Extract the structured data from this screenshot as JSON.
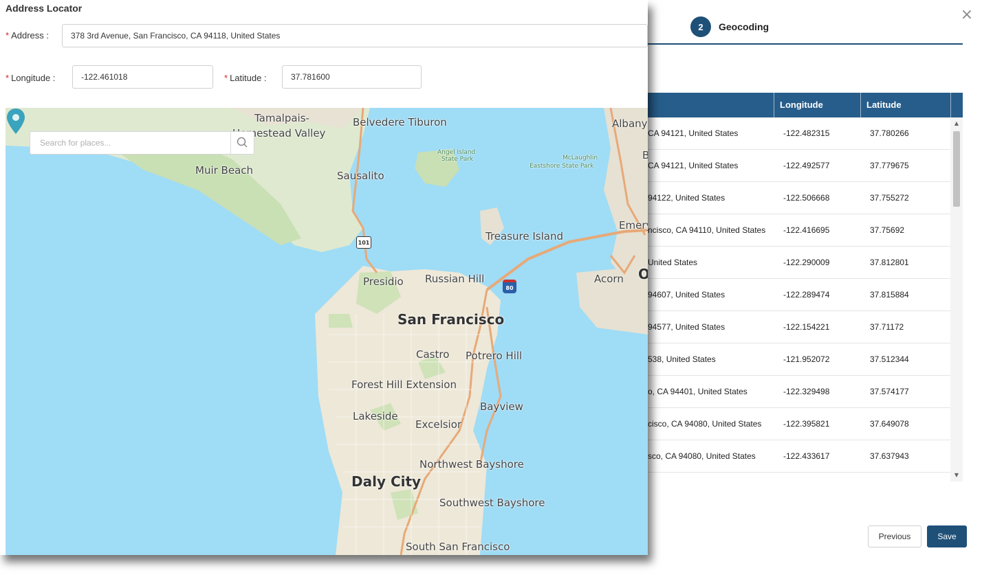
{
  "geocoding": {
    "step_number": "2",
    "step_label": "Geocoding",
    "columns": [
      "Longitude",
      "Latitude"
    ],
    "rows": [
      {
        "address": "CA 94121, United States",
        "longitude": "-122.482315",
        "latitude": "37.780266"
      },
      {
        "address": "CA 94121, United States",
        "longitude": "-122.492577",
        "latitude": "37.779675"
      },
      {
        "address": "94122, United States",
        "longitude": "-122.506668",
        "latitude": "37.755272"
      },
      {
        "address": "ncisco, CA 94110, United States",
        "longitude": "-122.416695",
        "latitude": "37.75692"
      },
      {
        "address": "United States",
        "longitude": "-122.290009",
        "latitude": "37.812801"
      },
      {
        "address": "94607, United States",
        "longitude": "-122.289474",
        "latitude": "37.815884"
      },
      {
        "address": "94577, United States",
        "longitude": "-122.154221",
        "latitude": "37.71172"
      },
      {
        "address": "538, United States",
        "longitude": "-121.952072",
        "latitude": "37.512344"
      },
      {
        "address": "o, CA 94401, United States",
        "longitude": "-122.329498",
        "latitude": "37.574177"
      },
      {
        "address": "cisco, CA 94080, United States",
        "longitude": "-122.395821",
        "latitude": "37.649078"
      },
      {
        "address": "sco, CA 94080, United States",
        "longitude": "-122.433617",
        "latitude": "37.637943"
      }
    ],
    "previous_label": "Previous",
    "save_label": "Save",
    "close_glyph": "×"
  },
  "locator": {
    "title": "Address Locator",
    "required_mark": "*",
    "address_label": "Address :",
    "address_value": "378 3rd Avenue, San Francisco, CA 94118, United States",
    "longitude_label": "Longitude :",
    "longitude_value": "-122.461018",
    "latitude_label": "Latitude :",
    "latitude_value": "37.781600"
  },
  "map": {
    "search_placeholder": "Search for places...",
    "labels": {
      "tamalpais": "Tamalpais-",
      "homestead": "Homestead Valley",
      "belvedere": "Belvedere Tiburon",
      "albany": "Albany",
      "muir": "Muir Beach",
      "sausalito": "Sausalito",
      "angel": "Angel Island",
      "angel2": "State Park",
      "mclaughlin": "McLaughlin",
      "mclaughlin2": "Eastshore State Park",
      "b": "B",
      "emery": "Emery",
      "treasure": "Treasure Island",
      "presidio": "Presidio",
      "russian": "Russian Hill",
      "acorn": "Acorn",
      "o": "O",
      "sf": "San Francisco",
      "castro": "Castro",
      "potrero": "Potrero Hill",
      "forest": "Forest Hill Extension",
      "bayview": "Bayview",
      "lakeside": "Lakeside",
      "excelsior": "Excelsior",
      "nwbay": "Northwest Bayshore",
      "daly": "Daly City",
      "swbay": "Southwest Bayshore",
      "ssf": "South San Francisco",
      "hw101": "101",
      "i80": "80"
    }
  }
}
